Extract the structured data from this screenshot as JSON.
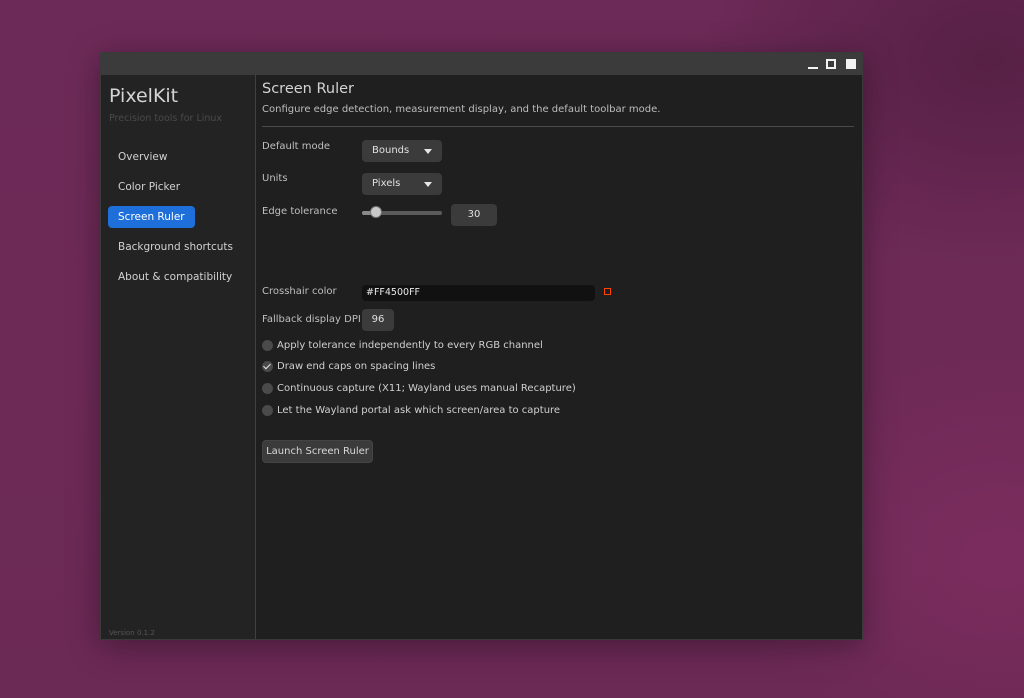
{
  "window": {
    "controls": [
      "minimize-icon",
      "maximize-icon",
      "close-icon"
    ]
  },
  "sidebar": {
    "app_title": "PixelKit",
    "app_subtitle": "Precision tools for Linux",
    "items": [
      {
        "label": "Overview",
        "active": false
      },
      {
        "label": "Color Picker",
        "active": false
      },
      {
        "label": "Screen Ruler",
        "active": true
      },
      {
        "label": "Background shortcuts",
        "active": false
      },
      {
        "label": "About & compatibility",
        "active": false
      }
    ],
    "version": "Version 0.1.2"
  },
  "main": {
    "title": "Screen Ruler",
    "description": "Configure edge detection, measurement display, and the default toolbar mode.",
    "default_mode": {
      "label": "Default mode",
      "value": "Bounds"
    },
    "units": {
      "label": "Units",
      "value": "Pixels"
    },
    "edge_tolerance": {
      "label": "Edge tolerance",
      "value": "30",
      "slider_fraction": 0.18
    },
    "crosshair_color": {
      "label": "Crosshair color",
      "value": "#FF4500FF",
      "swatch_color": "#ff4500"
    },
    "fallback_dpi": {
      "label": "Fallback display DPI",
      "value": "96"
    },
    "options": [
      {
        "label": "Apply tolerance independently to every RGB channel",
        "checked": false
      },
      {
        "label": "Draw end caps on spacing lines",
        "checked": true
      },
      {
        "label": "Continuous capture (X11; Wayland uses manual Recapture)",
        "checked": false
      },
      {
        "label": "Let the Wayland portal ask which screen/area to capture",
        "checked": false
      }
    ],
    "launch_button": "Launch Screen Ruler"
  },
  "colors": {
    "accent": "#1e6fd9",
    "background": "#6c2a58",
    "window": "#1f1f1f"
  }
}
